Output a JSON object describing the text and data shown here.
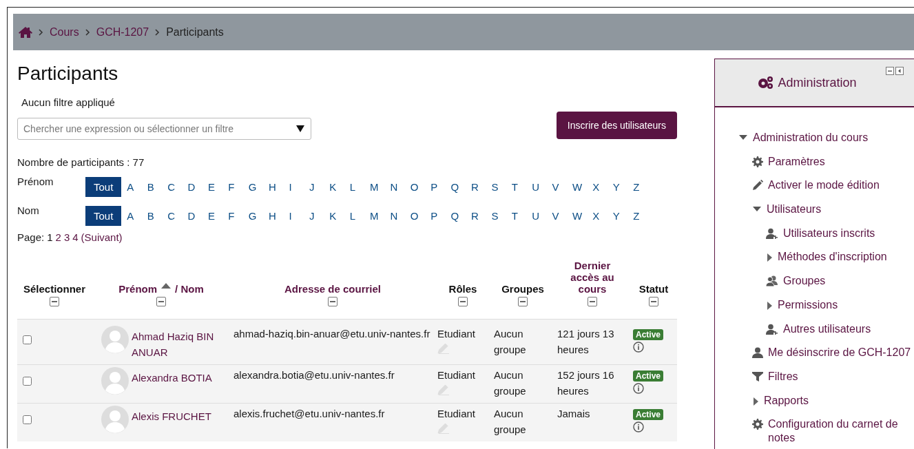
{
  "breadcrumb": [
    {
      "kind": "home"
    },
    {
      "kind": "link",
      "label": "Cours"
    },
    {
      "kind": "link",
      "label": "GCH-1207"
    },
    {
      "kind": "current",
      "label": "Participants"
    }
  ],
  "page_title": "Participants",
  "filter_status": "Aucun filtre appliqué",
  "filter_field": {
    "placeholder": "Chercher une expression ou sélectionner un filtre"
  },
  "enrol_button": "Inscrire des utilisateurs",
  "participant_count": "Nombre de participants : 77",
  "initials_bars": [
    {
      "label": "Prénom",
      "letters": [
        {
          "text": "Tout",
          "selected": true
        },
        {
          "text": "A",
          "selected": false
        },
        {
          "text": "B",
          "selected": false
        },
        {
          "text": "C",
          "selected": false
        },
        {
          "text": "D",
          "selected": false
        },
        {
          "text": "E",
          "selected": false
        },
        {
          "text": "F",
          "selected": false
        },
        {
          "text": "G",
          "selected": false
        },
        {
          "text": "H",
          "selected": false
        },
        {
          "text": "I",
          "selected": false
        },
        {
          "text": "J",
          "selected": false
        },
        {
          "text": "K",
          "selected": false
        },
        {
          "text": "L",
          "selected": false
        },
        {
          "text": "M",
          "selected": false
        },
        {
          "text": "N",
          "selected": false
        },
        {
          "text": "O",
          "selected": false
        },
        {
          "text": "P",
          "selected": false
        },
        {
          "text": "Q",
          "selected": false
        },
        {
          "text": "R",
          "selected": false
        },
        {
          "text": "S",
          "selected": false
        },
        {
          "text": "T",
          "selected": false
        },
        {
          "text": "U",
          "selected": false
        },
        {
          "text": "V",
          "selected": false
        },
        {
          "text": "W",
          "selected": false
        },
        {
          "text": "X",
          "selected": false
        },
        {
          "text": "Y",
          "selected": false
        },
        {
          "text": "Z",
          "selected": false
        }
      ]
    },
    {
      "label": "Nom",
      "letters": [
        {
          "text": "Tout",
          "selected": true
        },
        {
          "text": "A",
          "selected": false
        },
        {
          "text": "B",
          "selected": false
        },
        {
          "text": "C",
          "selected": false
        },
        {
          "text": "D",
          "selected": false
        },
        {
          "text": "E",
          "selected": false
        },
        {
          "text": "F",
          "selected": false
        },
        {
          "text": "G",
          "selected": false
        },
        {
          "text": "H",
          "selected": false
        },
        {
          "text": "I",
          "selected": false
        },
        {
          "text": "J",
          "selected": false
        },
        {
          "text": "K",
          "selected": false
        },
        {
          "text": "L",
          "selected": false
        },
        {
          "text": "M",
          "selected": false
        },
        {
          "text": "N",
          "selected": false
        },
        {
          "text": "O",
          "selected": false
        },
        {
          "text": "P",
          "selected": false
        },
        {
          "text": "Q",
          "selected": false
        },
        {
          "text": "R",
          "selected": false
        },
        {
          "text": "S",
          "selected": false
        },
        {
          "text": "T",
          "selected": false
        },
        {
          "text": "U",
          "selected": false
        },
        {
          "text": "V",
          "selected": false
        },
        {
          "text": "W",
          "selected": false
        },
        {
          "text": "X",
          "selected": false
        },
        {
          "text": "Y",
          "selected": false
        },
        {
          "text": "Z",
          "selected": false
        }
      ]
    }
  ],
  "pagination": {
    "label": "Page:",
    "pages": [
      {
        "text": "1",
        "selected": true
      },
      {
        "text": "2",
        "selected": false
      },
      {
        "text": "3",
        "selected": false
      },
      {
        "text": "4",
        "selected": false
      }
    ],
    "next": "(Suivant)"
  },
  "table": {
    "columns": [
      {
        "label": "Sélectionner",
        "sortable": false
      },
      {
        "label": "Prénom",
        "sortable": true,
        "sorted": true,
        "label_2": "/ Nom"
      },
      {
        "label": "Adresse de courriel",
        "sortable": true
      },
      {
        "label": "Rôles",
        "sortable": false
      },
      {
        "label": "Groupes",
        "sortable": false
      },
      {
        "label": "Dernier accès au cours",
        "sortable": true
      },
      {
        "label": "Statut",
        "sortable": false
      }
    ],
    "rows": [
      {
        "checked": false,
        "name": "Ahmad Haziq BIN ANUAR",
        "email": "ahmad-haziq.bin-anuar@etu.univ-nantes.fr",
        "role": "Etudiant",
        "group": "Aucun groupe",
        "last_access": "121 jours 13 heures",
        "status": "Active"
      },
      {
        "checked": false,
        "name": "Alexandra BOTIA",
        "email": "alexandra.botia@etu.univ-nantes.fr",
        "role": "Etudiant",
        "group": "Aucun groupe",
        "last_access": "152 jours 16 heures",
        "status": "Active"
      },
      {
        "checked": false,
        "name": "Alexis FRUCHET",
        "email": "alexis.fruchet@etu.univ-nantes.fr",
        "role": "Etudiant",
        "group": "Aucun groupe",
        "last_access": "Jamais",
        "status": "Active"
      }
    ]
  },
  "admin_block": {
    "title": "Administration",
    "tree": [
      {
        "kind": "branch",
        "label": "Administration du cours",
        "expanded": true,
        "children": [
          {
            "kind": "gear",
            "label": "Paramètres"
          },
          {
            "kind": "pencil",
            "label": "Activer le mode édition"
          },
          {
            "kind": "branch",
            "label": "Utilisateurs",
            "expanded": true,
            "children": [
              {
                "kind": "user-add",
                "label": "Utilisateurs inscrits"
              },
              {
                "kind": "branch",
                "label": "Méthodes d'inscription",
                "expanded": false
              },
              {
                "kind": "group",
                "label": "Groupes"
              },
              {
                "kind": "branch",
                "label": "Permissions",
                "expanded": false
              },
              {
                "kind": "user-add",
                "label": "Autres utilisateurs"
              }
            ]
          },
          {
            "kind": "user",
            "label": "Me désinscrire de GCH-1207"
          },
          {
            "kind": "filter",
            "label": "Filtres"
          },
          {
            "kind": "branch",
            "label": "Rapports",
            "expanded": false
          },
          {
            "kind": "gear",
            "label": "Configuration du carnet de notes"
          }
        ]
      }
    ]
  }
}
